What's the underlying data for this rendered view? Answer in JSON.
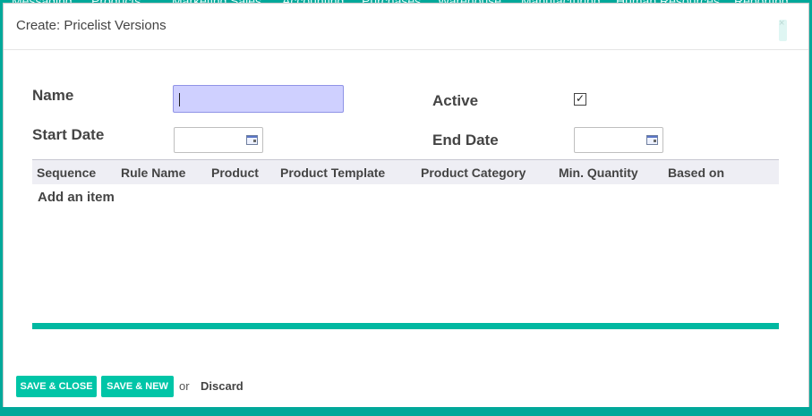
{
  "app": {
    "nav_items": [
      "Messaging",
      "Products",
      "Marketing",
      "Sales",
      "Accounting",
      "Purchases",
      "Warehouse",
      "Manufacturing",
      "Human Resources",
      "Reporting"
    ]
  },
  "dialog": {
    "title": "Create: Pricelist Versions",
    "close_glyph": "×"
  },
  "form": {
    "name_label": "Name",
    "name_value": "",
    "active_label": "Active",
    "active_checked": true,
    "active_glyph": "✓",
    "start_date_label": "Start Date",
    "start_date_value": "",
    "end_date_label": "End Date",
    "end_date_value": ""
  },
  "table": {
    "columns": [
      "Sequence",
      "Rule Name",
      "Product",
      "Product Template",
      "Product Category",
      "Min. Quantity",
      "Based on"
    ],
    "rows": [],
    "add_item_label": "Add an item"
  },
  "footer": {
    "save_close_label": "SAVE & CLOSE",
    "save_new_label": "SAVE & NEW",
    "or_label": "or",
    "discard_label": "Discard"
  },
  "colors": {
    "accent": "#00c5a7",
    "nav_bg": "#00a89a",
    "focused_input": "#cfd0ff"
  },
  "icons": {
    "date_picker": "calendar-icon",
    "close": "close-icon",
    "checkbox": "checkmark-icon"
  }
}
